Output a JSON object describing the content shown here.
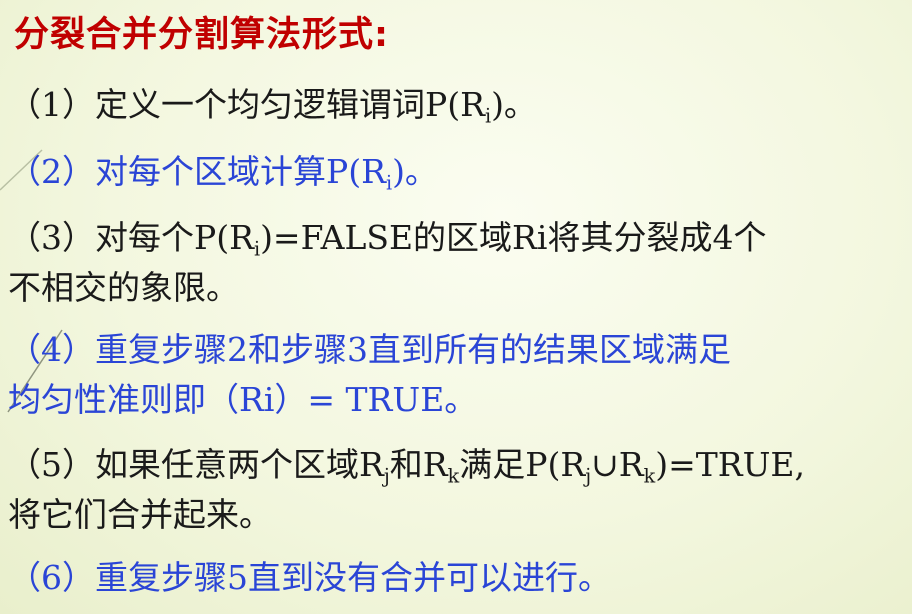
{
  "title": "分裂合并分割算法形式:",
  "items": [
    {
      "num": "（1）",
      "parts": [
        "定义一个均匀逻辑谓词P(R",
        "i",
        ")。"
      ]
    },
    {
      "num": "（2）",
      "parts": [
        "对每个区域计算P(R",
        "i",
        ")。"
      ]
    },
    {
      "num": "（3）",
      "parts": [
        "对每个P(R",
        "i",
        ")=FALSE的区域Ri将其分裂成4个",
        "不相交的象限。"
      ]
    },
    {
      "num": "（4）",
      "lines": [
        "重复步骤2和步骤3直到所有的结果区域满足",
        "均匀性准则即（Ri）= TRUE。"
      ]
    },
    {
      "num": "（5）",
      "parts": [
        "如果任意两个区域R",
        "j",
        "和R",
        "k",
        "满足P(R",
        "j",
        "∪R",
        "k",
        ")=TRUE,",
        "将它们合并起来。"
      ]
    },
    {
      "num": "（6）",
      "parts": [
        "重复步骤5直到没有合并可以进行。"
      ]
    }
  ],
  "colors": {
    "title": "#c00000",
    "black_text": "#1a1a1a",
    "blue_text": "#2a45d6"
  }
}
